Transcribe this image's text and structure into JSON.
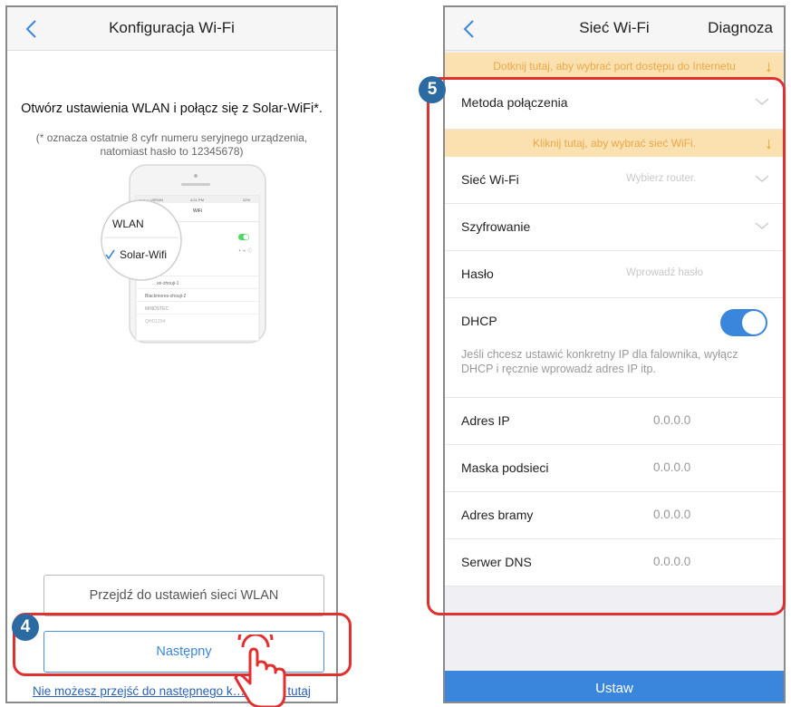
{
  "left_screen": {
    "title": "Konfiguracja Wi-Fi",
    "heading": "Otwórz ustawienia WLAN i połącz się z Solar-WiFi*.",
    "note_line1": "(* oznacza ostatnie 8 cyfr numeru seryjnego urządzenia,",
    "note_line2": "natomiast hasło to 12345678)",
    "illustration": {
      "status_left": "●●●○○ VIRGIN",
      "status_time": "4:21 PM",
      "status_battery": "22%",
      "wifi_header": "WiFi",
      "zoom_wlan": "WLAN",
      "zoom_network": "Solar-Wifi",
      "list": [
        "…ve-zhouji-1",
        "Blackmores-zhouji-2",
        "MINDSTEC",
        "QHD1204"
      ]
    },
    "wlan_button": "Przejdź do ustawień sieci WLAN",
    "next_button": "Następny",
    "bottom_link": "Nie możesz przejść do następnego k… …liknij tutaj"
  },
  "right_screen": {
    "title": "Sieć Wi-Fi",
    "diagnose": "Diagnoza",
    "banner_top": "Dotknij tutaj, aby wybrać port dostępu do Internetu",
    "method_label": "Metoda połączenia",
    "banner_mid": "Kliknij tutaj, aby wybrać sieć WiFi.",
    "wifi_label": "Sieć Wi-Fi",
    "wifi_placeholder": "Wybierz router.",
    "encryption_label": "Szyfrowanie",
    "password_label": "Hasło",
    "password_placeholder": "Wprowadź hasło",
    "dhcp_label": "DHCP",
    "dhcp_enabled": true,
    "dhcp_note": "Jeśli chcesz ustawić konkretny IP dla falownika, wyłącz DHCP i ręcznie wprowadź adres IP itp.",
    "ip_label": "Adres IP",
    "ip_value": "0.0.0.0",
    "mask_label": "Maska podsieci",
    "mask_value": "0.0.0.0",
    "gateway_label": "Adres bramy",
    "gateway_value": "0.0.0.0",
    "dns_label": "Serwer DNS",
    "dns_value": "0.0.0.0",
    "set_button": "Ustaw"
  },
  "badges": {
    "step4": "4",
    "step5": "5"
  },
  "colors": {
    "accent": "#3a86dc",
    "highlight": "#e03030",
    "badge": "#2c6ba1",
    "banner": "#fbe1b0",
    "banner_text": "#e8a84a"
  }
}
